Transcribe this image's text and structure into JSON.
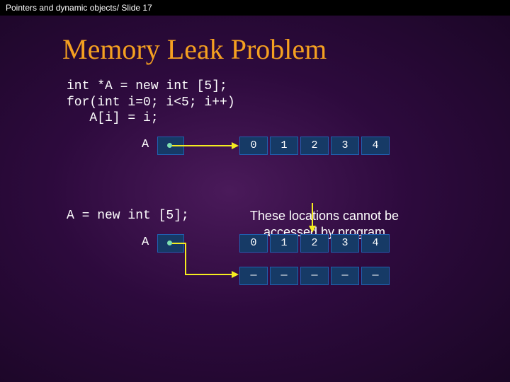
{
  "topbar": "Pointers and dynamic objects/ Slide 17",
  "title": "Memory Leak Problem",
  "code1_line1": "int *A = new int [5];",
  "code1_line2": "for(int i=0; i<5; i++)",
  "code1_line3": "   A[i] = i;",
  "code2": "A = new int [5];",
  "ptr_label": "A",
  "row1": [
    "0",
    "1",
    "2",
    "3",
    "4"
  ],
  "row2": [
    "0",
    "1",
    "2",
    "3",
    "4"
  ],
  "row3": [
    "—",
    "—",
    "—",
    "—",
    "—"
  ],
  "note_line1": "These locations cannot be",
  "note_line2": "accessed by program"
}
